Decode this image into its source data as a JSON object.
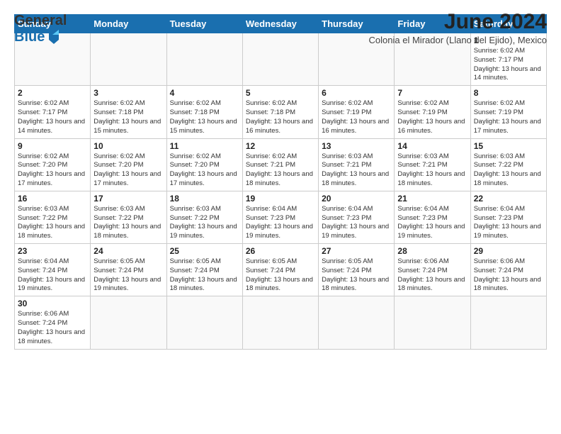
{
  "header": {
    "logo_general": "General",
    "logo_blue": "Blue",
    "month_year": "June 2024",
    "location": "Colonia el Mirador (Llano del Ejido), Mexico"
  },
  "weekdays": [
    "Sunday",
    "Monday",
    "Tuesday",
    "Wednesday",
    "Thursday",
    "Friday",
    "Saturday"
  ],
  "weeks": [
    [
      {
        "day": "",
        "info": ""
      },
      {
        "day": "",
        "info": ""
      },
      {
        "day": "",
        "info": ""
      },
      {
        "day": "",
        "info": ""
      },
      {
        "day": "",
        "info": ""
      },
      {
        "day": "",
        "info": ""
      },
      {
        "day": "1",
        "info": "Sunrise: 6:02 AM\nSunset: 7:17 PM\nDaylight: 13 hours and 14 minutes."
      }
    ],
    [
      {
        "day": "2",
        "info": "Sunrise: 6:02 AM\nSunset: 7:17 PM\nDaylight: 13 hours and 14 minutes."
      },
      {
        "day": "3",
        "info": "Sunrise: 6:02 AM\nSunset: 7:18 PM\nDaylight: 13 hours and 15 minutes."
      },
      {
        "day": "4",
        "info": "Sunrise: 6:02 AM\nSunset: 7:18 PM\nDaylight: 13 hours and 15 minutes."
      },
      {
        "day": "5",
        "info": "Sunrise: 6:02 AM\nSunset: 7:18 PM\nDaylight: 13 hours and 16 minutes."
      },
      {
        "day": "6",
        "info": "Sunrise: 6:02 AM\nSunset: 7:19 PM\nDaylight: 13 hours and 16 minutes."
      },
      {
        "day": "7",
        "info": "Sunrise: 6:02 AM\nSunset: 7:19 PM\nDaylight: 13 hours and 16 minutes."
      },
      {
        "day": "8",
        "info": "Sunrise: 6:02 AM\nSunset: 7:19 PM\nDaylight: 13 hours and 17 minutes."
      }
    ],
    [
      {
        "day": "9",
        "info": "Sunrise: 6:02 AM\nSunset: 7:20 PM\nDaylight: 13 hours and 17 minutes."
      },
      {
        "day": "10",
        "info": "Sunrise: 6:02 AM\nSunset: 7:20 PM\nDaylight: 13 hours and 17 minutes."
      },
      {
        "day": "11",
        "info": "Sunrise: 6:02 AM\nSunset: 7:20 PM\nDaylight: 13 hours and 17 minutes."
      },
      {
        "day": "12",
        "info": "Sunrise: 6:02 AM\nSunset: 7:21 PM\nDaylight: 13 hours and 18 minutes."
      },
      {
        "day": "13",
        "info": "Sunrise: 6:03 AM\nSunset: 7:21 PM\nDaylight: 13 hours and 18 minutes."
      },
      {
        "day": "14",
        "info": "Sunrise: 6:03 AM\nSunset: 7:21 PM\nDaylight: 13 hours and 18 minutes."
      },
      {
        "day": "15",
        "info": "Sunrise: 6:03 AM\nSunset: 7:22 PM\nDaylight: 13 hours and 18 minutes."
      }
    ],
    [
      {
        "day": "16",
        "info": "Sunrise: 6:03 AM\nSunset: 7:22 PM\nDaylight: 13 hours and 18 minutes."
      },
      {
        "day": "17",
        "info": "Sunrise: 6:03 AM\nSunset: 7:22 PM\nDaylight: 13 hours and 18 minutes."
      },
      {
        "day": "18",
        "info": "Sunrise: 6:03 AM\nSunset: 7:22 PM\nDaylight: 13 hours and 19 minutes."
      },
      {
        "day": "19",
        "info": "Sunrise: 6:04 AM\nSunset: 7:23 PM\nDaylight: 13 hours and 19 minutes."
      },
      {
        "day": "20",
        "info": "Sunrise: 6:04 AM\nSunset: 7:23 PM\nDaylight: 13 hours and 19 minutes."
      },
      {
        "day": "21",
        "info": "Sunrise: 6:04 AM\nSunset: 7:23 PM\nDaylight: 13 hours and 19 minutes."
      },
      {
        "day": "22",
        "info": "Sunrise: 6:04 AM\nSunset: 7:23 PM\nDaylight: 13 hours and 19 minutes."
      }
    ],
    [
      {
        "day": "23",
        "info": "Sunrise: 6:04 AM\nSunset: 7:24 PM\nDaylight: 13 hours and 19 minutes."
      },
      {
        "day": "24",
        "info": "Sunrise: 6:05 AM\nSunset: 7:24 PM\nDaylight: 13 hours and 19 minutes."
      },
      {
        "day": "25",
        "info": "Sunrise: 6:05 AM\nSunset: 7:24 PM\nDaylight: 13 hours and 18 minutes."
      },
      {
        "day": "26",
        "info": "Sunrise: 6:05 AM\nSunset: 7:24 PM\nDaylight: 13 hours and 18 minutes."
      },
      {
        "day": "27",
        "info": "Sunrise: 6:05 AM\nSunset: 7:24 PM\nDaylight: 13 hours and 18 minutes."
      },
      {
        "day": "28",
        "info": "Sunrise: 6:06 AM\nSunset: 7:24 PM\nDaylight: 13 hours and 18 minutes."
      },
      {
        "day": "29",
        "info": "Sunrise: 6:06 AM\nSunset: 7:24 PM\nDaylight: 13 hours and 18 minutes."
      }
    ],
    [
      {
        "day": "30",
        "info": "Sunrise: 6:06 AM\nSunset: 7:24 PM\nDaylight: 13 hours and 18 minutes."
      },
      {
        "day": "",
        "info": ""
      },
      {
        "day": "",
        "info": ""
      },
      {
        "day": "",
        "info": ""
      },
      {
        "day": "",
        "info": ""
      },
      {
        "day": "",
        "info": ""
      },
      {
        "day": "",
        "info": ""
      }
    ]
  ]
}
